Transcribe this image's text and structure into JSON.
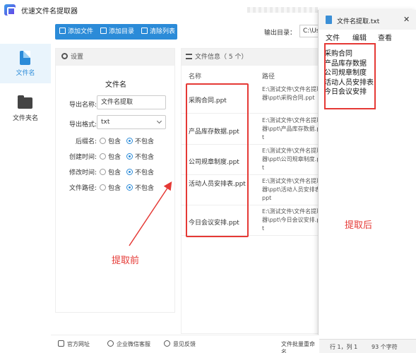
{
  "app": {
    "title": "优速文件名提取器"
  },
  "sidebar": {
    "items": [
      {
        "label": "文件名",
        "active": true
      },
      {
        "label": "文件夹名",
        "active": false
      }
    ]
  },
  "toolbar": {
    "add_file": "添加文件",
    "add_dir": "添加目录",
    "clear_list": "清除列表",
    "accent": "#2b8bd8"
  },
  "output": {
    "label": "输出目录：",
    "value": "C:\\Us"
  },
  "settings": {
    "header": "设置",
    "section": "文件名",
    "export_name_label": "导出名称:",
    "export_name_value": "文件名提取",
    "export_format_label": "导出格式:",
    "export_format_value": "txt",
    "options": [
      {
        "label": "后缀名:",
        "include": "包含",
        "exclude": "不包含",
        "selected": "exclude"
      },
      {
        "label": "创建时间:",
        "include": "包含",
        "exclude": "不包含",
        "selected": "exclude"
      },
      {
        "label": "修改时间:",
        "include": "包含",
        "exclude": "不包含",
        "selected": "exclude"
      },
      {
        "label": "文件路径:",
        "include": "包含",
        "exclude": "不包含",
        "selected": "exclude"
      }
    ]
  },
  "fileinfo": {
    "header": "文件信息（ 5 个）",
    "col_name": "名称",
    "col_path": "路径",
    "rows": [
      {
        "name": "采购合同.ppt",
        "path": "E:\\测试文件\\文件名提取器\\ppt\\采购合同.ppt"
      },
      {
        "name": "产品库存数据.ppt",
        "path": "E:\\测试文件\\文件名提取器\\ppt\\产品库存数据.ppt"
      },
      {
        "name": "公司规章制度.ppt",
        "path": "E:\\测试文件\\文件名提取器\\ppt\\公司规章制度.ppt"
      },
      {
        "name": "活动人员安排表.ppt",
        "path": "E:\\测试文件\\文件名提取器\\ppt\\活动人员安排表.ppt"
      },
      {
        "name": "今日会议安排.ppt",
        "path": "E:\\测试文件\\文件名提取器\\ppt\\今日会议安排.ppt"
      }
    ]
  },
  "annotations": {
    "before": "提取前",
    "after": "提取后",
    "color": "#e53935"
  },
  "notepad": {
    "title": "文件名提取.txt",
    "menu": [
      "文件",
      "编辑",
      "查看"
    ],
    "lines": [
      "采购合同",
      "产品库存数据",
      "公司规章制度",
      "活动人员安排表",
      "今日会议安排"
    ],
    "status_pos": "行 1，列 1",
    "status_count": "93 个字符"
  },
  "footer": {
    "website": "官方网址",
    "wechat": "企业微信客服",
    "feedback": "意见反馈",
    "batch": "文件批量重命名"
  }
}
